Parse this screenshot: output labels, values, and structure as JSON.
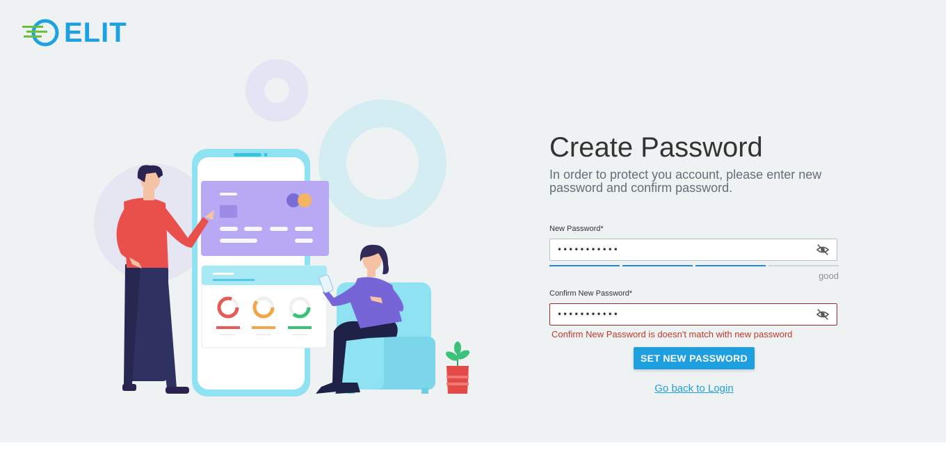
{
  "brand": {
    "name": "ELIT",
    "color": "#1da1e0",
    "accent": "#6abf3c"
  },
  "form": {
    "title": "Create Password",
    "subtitle": "In order to protect you account, please enter new password and confirm password.",
    "new_password": {
      "label": "New Password*",
      "value": "•••••••••••",
      "strength_label": "good",
      "strength_level": 0.75,
      "strength_colors": [
        "#1e88e5",
        "#1e88e5",
        "#1e88e5",
        "#d0d4d8"
      ]
    },
    "confirm_password": {
      "label": "Confirm New Password*",
      "value": "•••••••••••",
      "error": "Confirm New Password is doesn't match with new password"
    },
    "submit_label": "SET NEW PASSWORD",
    "back_link": "Go back to Login"
  },
  "icons": {
    "visibility_toggle": "eye-off-icon",
    "logo": "logo-icon"
  }
}
